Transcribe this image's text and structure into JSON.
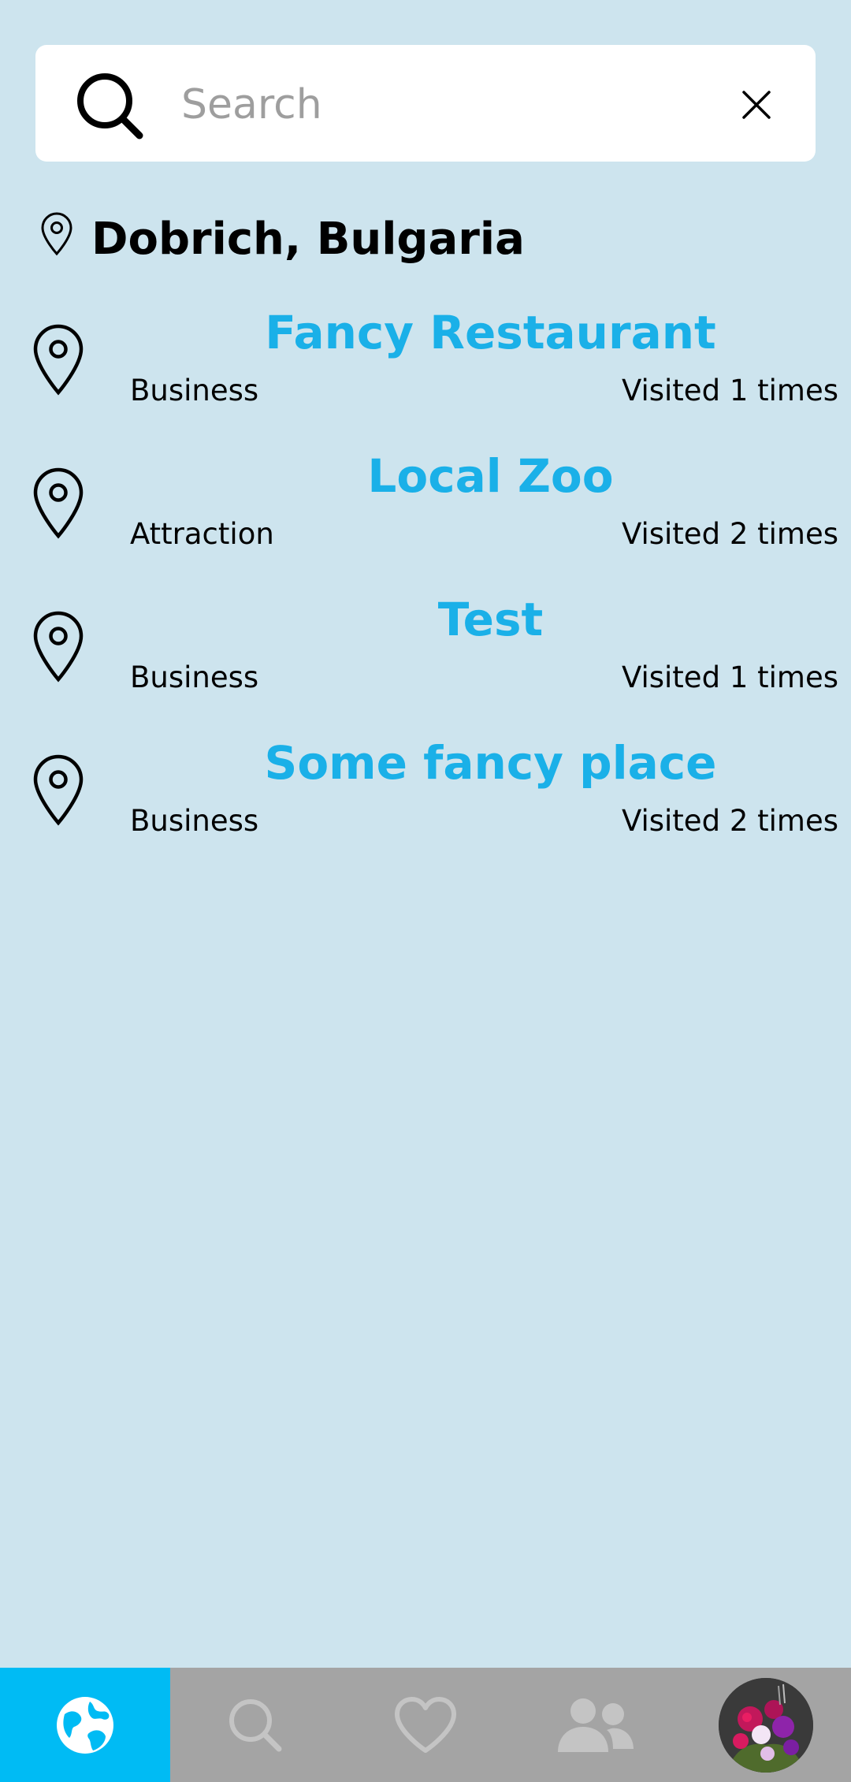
{
  "search": {
    "placeholder": "Search",
    "value": ""
  },
  "location": {
    "title": "Dobrich, Bulgaria"
  },
  "places": [
    {
      "name": "Fancy Restaurant",
      "type": "Business",
      "visits": "Visited 1 times"
    },
    {
      "name": "Local Zoo",
      "type": "Attraction",
      "visits": "Visited 2 times"
    },
    {
      "name": "Test",
      "type": "Business",
      "visits": "Visited 1 times"
    },
    {
      "name": "Some fancy place",
      "type": "Business",
      "visits": "Visited 2 times"
    }
  ],
  "nav": {
    "items": [
      {
        "icon": "globe-icon",
        "active": true
      },
      {
        "icon": "search-icon",
        "active": false
      },
      {
        "icon": "heart-icon",
        "active": false
      },
      {
        "icon": "people-icon",
        "active": false
      },
      {
        "icon": "avatar",
        "active": false
      }
    ]
  },
  "colors": {
    "background": "#cde4ee",
    "accent": "#1ab0e8",
    "nav_active": "#00bbf4",
    "nav_bar": "#a4a4a4"
  }
}
